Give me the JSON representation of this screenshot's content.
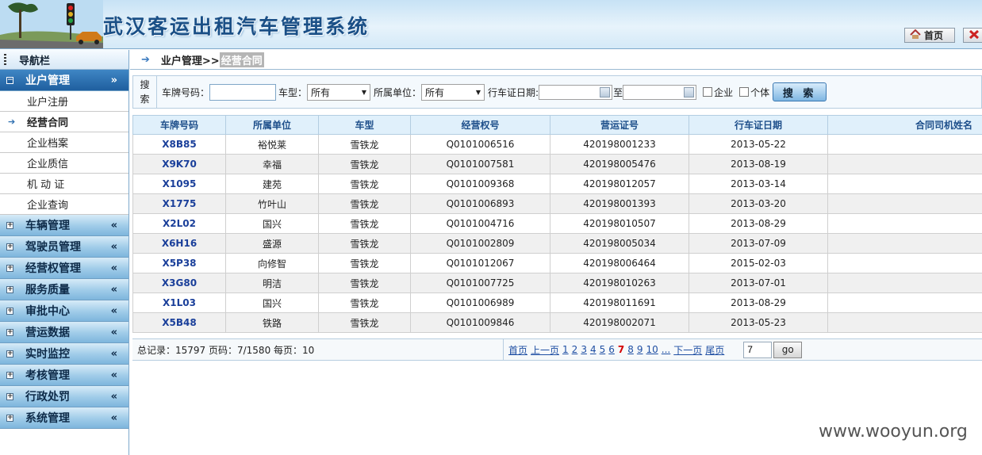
{
  "header": {
    "title": "武汉客运出租汽车管理系统",
    "home_label": "首页",
    "home_icon": "home-icon",
    "exit_icon": "close-icon"
  },
  "sidebar": {
    "title": "导航栏",
    "groups": [
      {
        "label": "业户管理",
        "expanded": true,
        "sub": [
          {
            "label": "业户注册"
          },
          {
            "label": "经营合同",
            "current": true
          },
          {
            "label": "企业档案"
          },
          {
            "label": "企业质信"
          },
          {
            "label": "机 动 证"
          },
          {
            "label": "企业查询"
          }
        ]
      },
      {
        "label": "车辆管理"
      },
      {
        "label": "驾驶员管理"
      },
      {
        "label": "经营权管理"
      },
      {
        "label": "服务质量"
      },
      {
        "label": "审批中心"
      },
      {
        "label": "营运数据"
      },
      {
        "label": "实时监控"
      },
      {
        "label": "考核管理"
      },
      {
        "label": "行政处罚"
      },
      {
        "label": "系统管理"
      }
    ]
  },
  "breadcrumb": {
    "parent": "业户管理>>",
    "current": "经营合同"
  },
  "search": {
    "tag_line1": "搜",
    "tag_line2": "索",
    "plate_label": "车牌号码：",
    "plate_value": "",
    "model_label": "车型：",
    "model_value": "所有",
    "unit_label": "所属单位：",
    "unit_value": "所有",
    "date_label": "行车证日期:",
    "date_from": "",
    "date_to_label": "至",
    "date_to": "",
    "enterprise_label": "企业",
    "individual_label": "个体",
    "search_button": "搜 索"
  },
  "table": {
    "columns": [
      "车牌号码",
      "所属单位",
      "车型",
      "经营权号",
      "营运证号",
      "行车证日期",
      "合同司机姓名"
    ],
    "rows": [
      [
        "X8B85",
        "裕悦莱",
        "雪铁龙",
        "Q0101006516",
        "420198001233",
        "2013-05-22",
        ""
      ],
      [
        "X9K70",
        "幸福",
        "雪铁龙",
        "Q0101007581",
        "420198005476",
        "2013-08-19",
        ""
      ],
      [
        "X1095",
        "建苑",
        "雪铁龙",
        "Q0101009368",
        "420198012057",
        "2013-03-14",
        ""
      ],
      [
        "X1775",
        "竹叶山",
        "雪铁龙",
        "Q0101006893",
        "420198001393",
        "2013-03-20",
        ""
      ],
      [
        "X2L02",
        "国兴",
        "雪铁龙",
        "Q0101004716",
        "420198010507",
        "2013-08-29",
        ""
      ],
      [
        "X6H16",
        "盛源",
        "雪铁龙",
        "Q0101002809",
        "420198005034",
        "2013-07-09",
        ""
      ],
      [
        "X5P38",
        "向修智",
        "雪铁龙",
        "Q0101012067",
        "420198006464",
        "2015-02-03",
        ""
      ],
      [
        "X3G80",
        "明洁",
        "雪铁龙",
        "Q0101007725",
        "420198010263",
        "2013-07-01",
        ""
      ],
      [
        "X1L03",
        "国兴",
        "雪铁龙",
        "Q0101006989",
        "420198011691",
        "2013-08-29",
        ""
      ],
      [
        "X5B48",
        "铁路",
        "雪铁龙",
        "Q0101009846",
        "420198002071",
        "2013-05-23",
        ""
      ]
    ]
  },
  "pager": {
    "summary": "总记录：15797 页码：7/1580 每页：10",
    "first": "首页",
    "prev": "上一页",
    "pages": [
      "1",
      "2",
      "3",
      "4",
      "5",
      "6",
      "7",
      "8",
      "9",
      "10"
    ],
    "current_page": "7",
    "ellipsis": "...",
    "next": "下一页",
    "last": "尾页",
    "jump_value": "7",
    "go_label": "go"
  },
  "watermark": "www.wooyun.org"
}
